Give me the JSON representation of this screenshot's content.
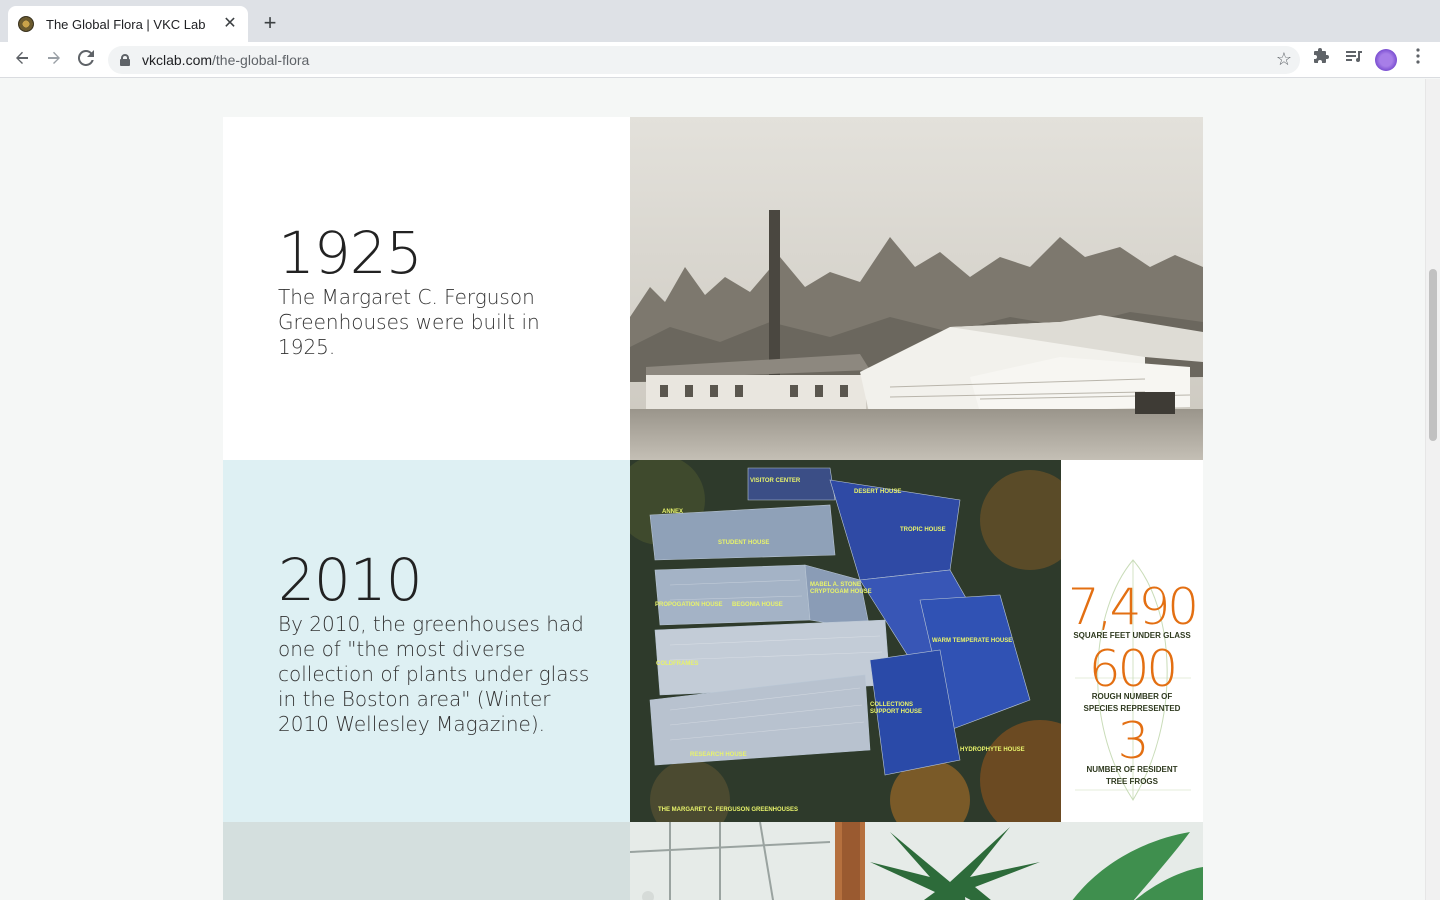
{
  "browser": {
    "tab_title": "The Global Flora | VKC Lab",
    "tab_close": "✕",
    "new_tab": "+",
    "url_host": "vkclab.com",
    "url_path": "/the-global-flora",
    "icons": [
      "back-icon",
      "forward-icon",
      "reload-icon",
      "lock-icon",
      "star-icon",
      "extensions-icon",
      "media-icon",
      "avatar",
      "menu-icon"
    ]
  },
  "timeline": [
    {
      "year": "1925",
      "caption": "The Margaret C. Ferguson Greenhouses were built in 1925."
    },
    {
      "year": "2010",
      "caption": "By 2010, the greenhouses had one of \"the most diverse collection of plants under glass in the Boston area\" (Winter 2010 Wellesley Magazine)."
    }
  ],
  "map_labels": {
    "visitor_center": "VISITOR CENTER",
    "desert_house": "DESERT HOUSE",
    "annex": "ANNEX",
    "tropic_house": "TROPIC HOUSE",
    "student_house": "STUDENT HOUSE",
    "stone_cryptogam_1": "MABEL A. STONE",
    "stone_cryptogam_2": "CRYPTOGAM HOUSE",
    "propogation_house": "PROPOGATION HOUSE",
    "begonia_house": "BEGONIA HOUSE",
    "warm_temperate_house": "WARM TEMPERATE HOUSE",
    "coldframes": "COLDFRAMES",
    "collections_support_1": "COLLECTIONS",
    "collections_support_2": "SUPPORT HOUSE",
    "research_house": "RESEARCH HOUSE",
    "hydrophyte_house": "HYDROPHYTE HOUSE",
    "footer": "THE MARGARET C. FERGUSON GREENHOUSES"
  },
  "stats": [
    {
      "number": "7,490",
      "label": "SQUARE FEET UNDER GLASS"
    },
    {
      "number": "600",
      "label_1": "ROUGH NUMBER OF",
      "label_2": "SPECIES REPRESENTED"
    },
    {
      "number": "3",
      "label_1": "NUMBER OF RESIDENT",
      "label_2": "TREE FROGS"
    }
  ],
  "colors": {
    "stat_orange": "#e36f12",
    "row2_bg": "#def0f3",
    "row3_bg": "#d4dfde",
    "map_label_yellow": "#e8f36b"
  }
}
